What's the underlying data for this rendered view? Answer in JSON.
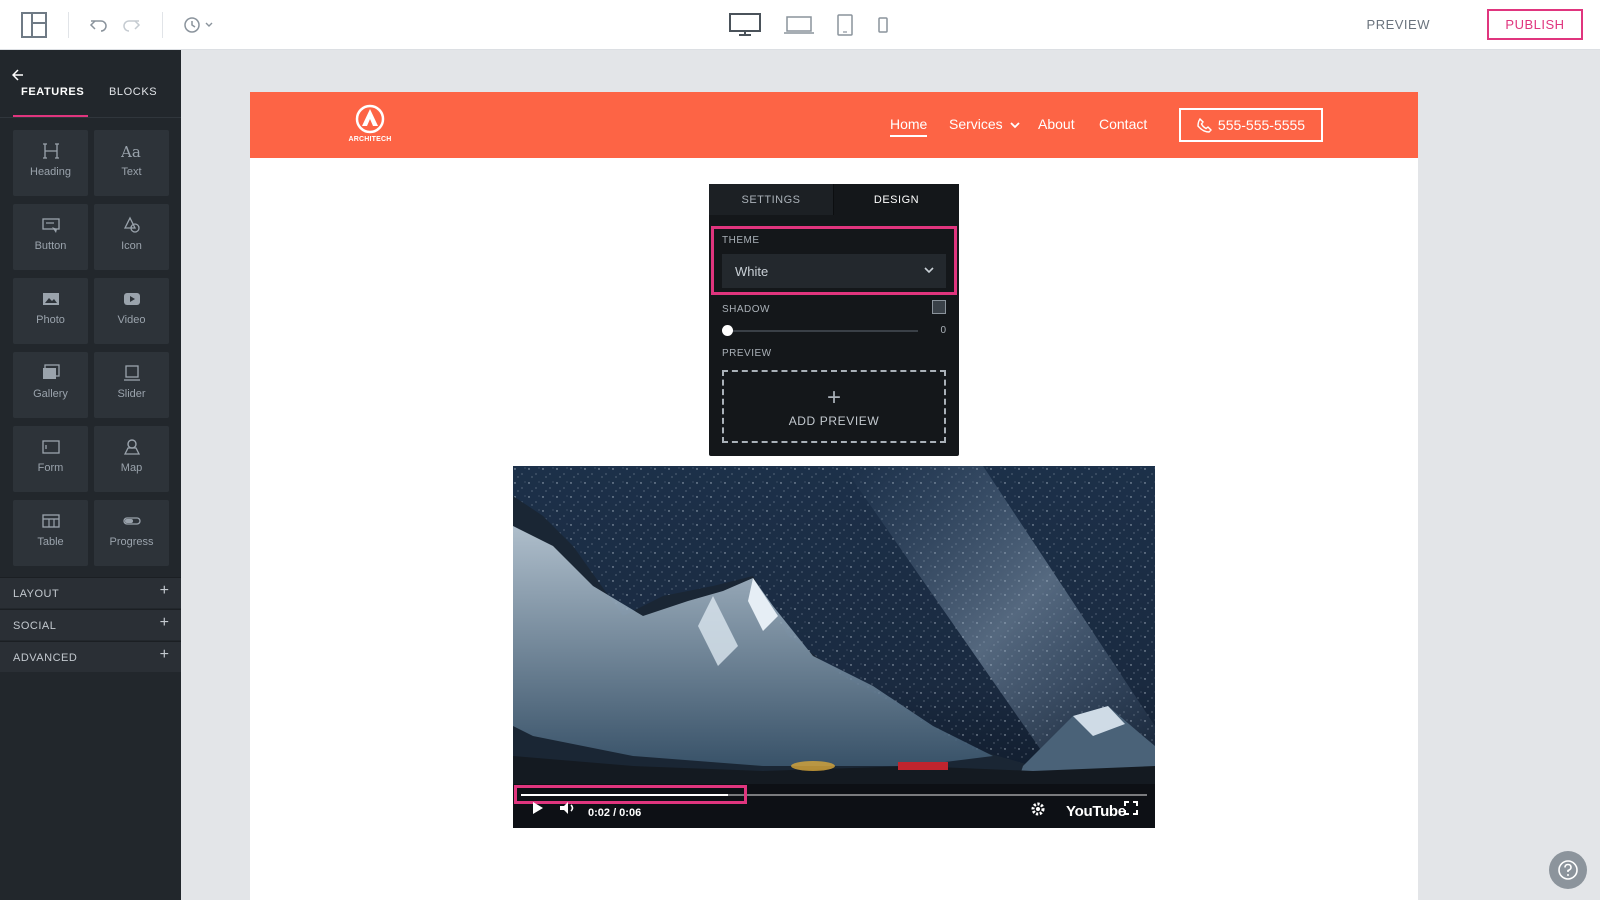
{
  "toolbar": {
    "layout_icon": "layout-icon",
    "undo_icon": "undo-icon",
    "redo_icon": "redo-icon",
    "history_icon": "history-icon",
    "devices": [
      "desktop-icon",
      "laptop-icon",
      "tablet-icon",
      "mobile-icon"
    ],
    "preview_label": "PREVIEW",
    "publish_label": "PUBLISH"
  },
  "sidebar": {
    "tabs": [
      {
        "label": "FEATURES",
        "active": true
      },
      {
        "label": "BLOCKS",
        "active": false
      }
    ],
    "features": [
      {
        "label": "Heading",
        "icon": "heading-icon"
      },
      {
        "label": "Text",
        "icon": "text-icon"
      },
      {
        "label": "Button",
        "icon": "button-icon"
      },
      {
        "label": "Icon",
        "icon": "icon-icon"
      },
      {
        "label": "Photo",
        "icon": "photo-icon"
      },
      {
        "label": "Video",
        "icon": "video-icon"
      },
      {
        "label": "Gallery",
        "icon": "gallery-icon"
      },
      {
        "label": "Slider",
        "icon": "slider-icon"
      },
      {
        "label": "Form",
        "icon": "form-icon"
      },
      {
        "label": "Map",
        "icon": "map-icon"
      },
      {
        "label": "Table",
        "icon": "table-icon"
      },
      {
        "label": "Progress",
        "icon": "progress-icon"
      }
    ],
    "sections": [
      {
        "label": "LAYOUT"
      },
      {
        "label": "SOCIAL"
      },
      {
        "label": "ADVANCED"
      }
    ]
  },
  "site": {
    "logo_text": "ARCHITECH",
    "nav": {
      "home": "Home",
      "services": "Services",
      "about": "About",
      "contact": "Contact"
    },
    "phone": "555-555-5555",
    "brand_color": "#fd6445"
  },
  "popup": {
    "tabs": {
      "settings": "SETTINGS",
      "design": "DESIGN"
    },
    "active_tab": "DESIGN",
    "theme_label": "THEME",
    "theme_value": "White",
    "shadow_label": "SHADOW",
    "shadow_value": "0",
    "shadow_checked": false,
    "preview_label": "PREVIEW",
    "add_preview_label": "ADD PREVIEW"
  },
  "video": {
    "time": "0:02 / 0:06",
    "progress_fraction": 0.33,
    "brand": "YouTube"
  },
  "colors": {
    "accent": "#e0357e",
    "sidebar_bg": "#22272c"
  }
}
